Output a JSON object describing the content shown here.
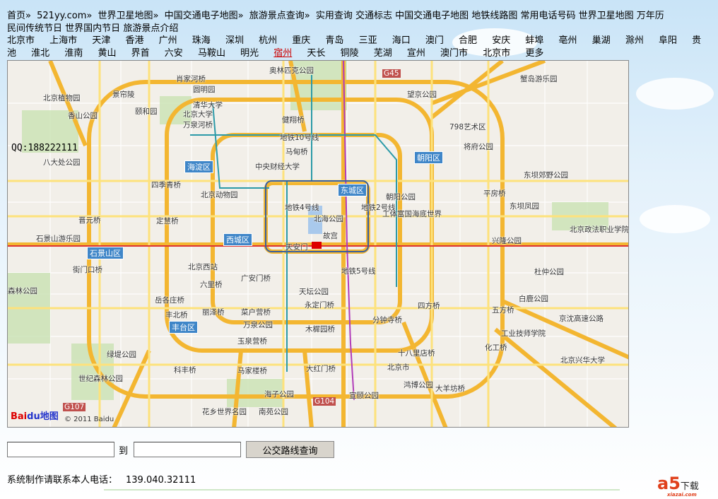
{
  "nav": {
    "breadcrumb": [
      "首页",
      "521yy.com",
      "世界卫星地图",
      "中国交通电子地图",
      "旅游景点查询"
    ],
    "links": [
      "实用查询",
      "交通标志",
      "中国交通电子地图",
      "地铁线路图",
      "常用电话号码",
      "世界卫星地图",
      "万年历",
      "民间传统节日",
      "世界国内节日",
      "旅游景点介绍"
    ]
  },
  "cities": [
    "北京市",
    "上海市",
    "天津",
    "香港",
    "广州",
    "珠海",
    "深圳",
    "杭州",
    "重庆",
    "青岛",
    "三亚",
    "海口",
    "澳门",
    "合肥",
    "安庆",
    "蚌埠",
    "亳州",
    "巢湖",
    "滁州",
    "阜阳",
    "贵池",
    "淮北",
    "淮南",
    "黄山",
    "界首",
    "六安",
    "马鞍山",
    "明光",
    "宿州",
    "天长",
    "铜陵",
    "芜湖",
    "宣州",
    "澳门市",
    "北京市",
    "更多"
  ],
  "active_city": "宿州",
  "map": {
    "qq": "QQ:188222111",
    "logo": "Bai",
    "logo2": "du地图",
    "copyright": "© 2011 Baidu",
    "districts": [
      "朝阳区",
      "海淀区",
      "东城区",
      "西城区",
      "石景山区",
      "丰台区"
    ],
    "labels": [
      "肖家河桥",
      "奥林匹克公园",
      "圆明园",
      "望京公园",
      "蟹岛游乐园",
      "北京植物园",
      "景帘陵",
      "清华大学",
      "北京大学",
      "颐和园",
      "香山公园",
      "万泉河桥",
      "健翔桥",
      "798艺术区",
      "地铁10号线",
      "马甸桥",
      "将府公园",
      "八大处公园",
      "中央财经大学",
      "东坝郊野公园",
      "四季青桥",
      "北京动物园",
      "朝阳公园",
      "平房桥",
      "晋元桥",
      "定慧桥",
      "北海公园",
      "工体富国海底世界",
      "东坝凤园",
      "石景山游乐园",
      "故宫",
      "天安门",
      "兴隆公园",
      "北京政法职业学院",
      "街门口桥",
      "北京西站",
      "广安门桥",
      "杜仲公园",
      "六里桥",
      "岳各庄桥",
      "天坛公园",
      "永定门桥",
      "四方桥",
      "白鹿公园",
      "丰北桥",
      "丽泽桥",
      "菜户营桥",
      "分钟寺桥",
      "五方桥",
      "京沈高速公路",
      "万泉公园",
      "木樨园桥",
      "工业技师学院",
      "玉泉营桥",
      "化工桥",
      "十八里店桥",
      "绿堤公园",
      "北京兴华大学",
      "科丰桥",
      "马家楼桥",
      "大红门桥",
      "北京市",
      "鸿博公园",
      "大羊坊桥",
      "世纪森林公园",
      "海子公园",
      "宣颐公园",
      "花乡世界名园",
      "南苑公园",
      "森林公园",
      "地铁4号线",
      "地铁5号线",
      "地铁2号线",
      "G45",
      "G104",
      "G107"
    ]
  },
  "form": {
    "from_value": "",
    "to_label": "到",
    "to_value": "",
    "search_button": "公交路线查询"
  },
  "contact": {
    "label": "系统制作请联系本人电话：",
    "phone": "139.040.32111"
  },
  "watermark": {
    "brand": "a5",
    "text": "下载",
    "site": "xiazai.com"
  }
}
